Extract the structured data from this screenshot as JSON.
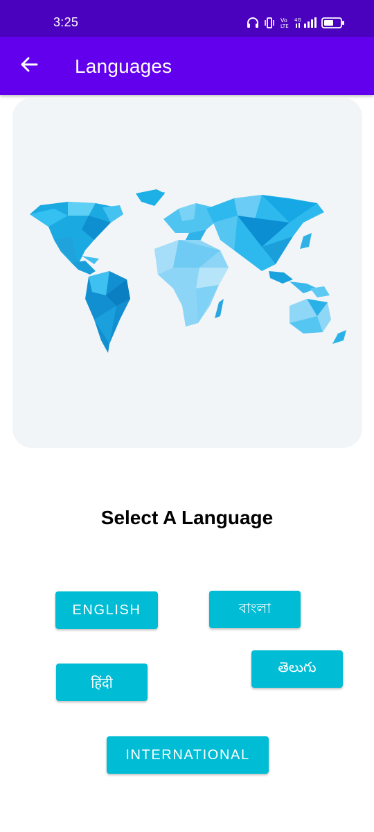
{
  "status_bar": {
    "time": "3:25",
    "icons": [
      "headphones-icon",
      "vibrate-icon",
      "volte-icon",
      "4g-signal-icon",
      "battery-icon"
    ]
  },
  "app_bar": {
    "title": "Languages",
    "back_icon": "arrow-back-icon"
  },
  "colors": {
    "status_bar": "#4a02bf",
    "app_bar": "#6200ee",
    "button": "#00bcd4",
    "map_card": "#f2f5f7"
  },
  "heading": "Select A Language",
  "languages": {
    "english": "ENGLISH",
    "bangla": "বাংলা",
    "telugu": "తెలుగు",
    "hindi": "हिंदी",
    "international": "INTERNATIONAL"
  }
}
